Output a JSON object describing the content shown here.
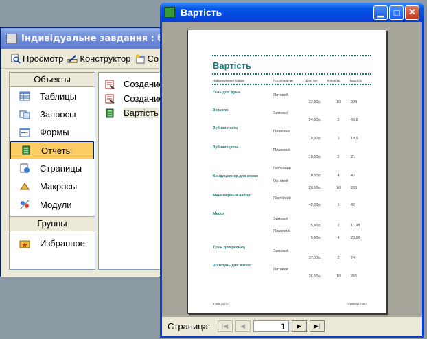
{
  "db_window": {
    "title": "Індивідуальне завдання : ба",
    "toolbar": {
      "preview": "Просмотр",
      "design": "Конструктор",
      "create": "Со"
    },
    "objects_header": "Объекты",
    "objects": [
      {
        "label": "Таблицы",
        "icon": "table-icon"
      },
      {
        "label": "Запросы",
        "icon": "query-icon"
      },
      {
        "label": "Формы",
        "icon": "form-icon"
      },
      {
        "label": "Отчеты",
        "icon": "report-icon",
        "selected": true
      },
      {
        "label": "Страницы",
        "icon": "page-icon"
      },
      {
        "label": "Макросы",
        "icon": "macro-icon"
      },
      {
        "label": "Модули",
        "icon": "module-icon"
      }
    ],
    "groups_header": "Группы",
    "groups": [
      {
        "label": "Избранное",
        "icon": "favorites-icon"
      }
    ],
    "list": [
      {
        "label": "Создание",
        "icon": "report-wizard-icon"
      },
      {
        "label": "Создание",
        "icon": "report-wizard-icon"
      },
      {
        "label": "Вартість",
        "icon": "report-icon",
        "selected": true
      }
    ]
  },
  "report_window": {
    "title": "Вартість",
    "nav": {
      "label": "Страница:",
      "page": "1"
    },
    "report": {
      "title": "Вартість",
      "columns": [
        "Найменування товару",
        "Постачальник",
        "Ціна, грн",
        "Кількість",
        "Вартість"
      ],
      "rows": [
        {
          "product": "Гель для душа",
          "supplier": "Оптовий",
          "price": "22,90р.",
          "qty": "10",
          "cost": "229"
        },
        {
          "product": "Зеркало",
          "supplier": "Зимовий",
          "price": "24,90р.",
          "qty": "2",
          "cost": "49,8"
        },
        {
          "product": "Зубная паста",
          "supplier": "Плавовий",
          "price": "19,90р.",
          "qty": "1",
          "cost": "19,9"
        },
        {
          "product": "Зубная щетка",
          "supplier": "Плавовий",
          "price": "10,50р.",
          "qty": "2",
          "cost": "21"
        },
        {
          "product": "",
          "supplier": "Постійний",
          "price": "10,50р.",
          "qty": "4",
          "cost": "42"
        },
        {
          "product": "Кондиционер для волос",
          "supplier": "Оптовий",
          "price": "26,50р.",
          "qty": "10",
          "cost": "265"
        },
        {
          "product": "Маникюрный набор",
          "supplier": "Постійний",
          "price": "42,00р.",
          "qty": "1",
          "cost": "42"
        },
        {
          "product": "Мыло",
          "supplier": "Зимовий",
          "price": "5,90р.",
          "qty": "2",
          "cost": "11,98"
        },
        {
          "product": "",
          "supplier": "Плавовий",
          "price": "5,90р.",
          "qty": "4",
          "cost": "23,96"
        },
        {
          "product": "Тушь для ресниц",
          "supplier": "Зимовий",
          "price": "37,00р.",
          "qty": "2",
          "cost": "74"
        },
        {
          "product": "Шампунь для волос",
          "supplier": "Оптовий",
          "price": "26,50р.",
          "qty": "10",
          "cost": "265"
        }
      ],
      "footer_left": "6 мая 2011 г.",
      "footer_right": "Страница 1 из 1"
    }
  }
}
